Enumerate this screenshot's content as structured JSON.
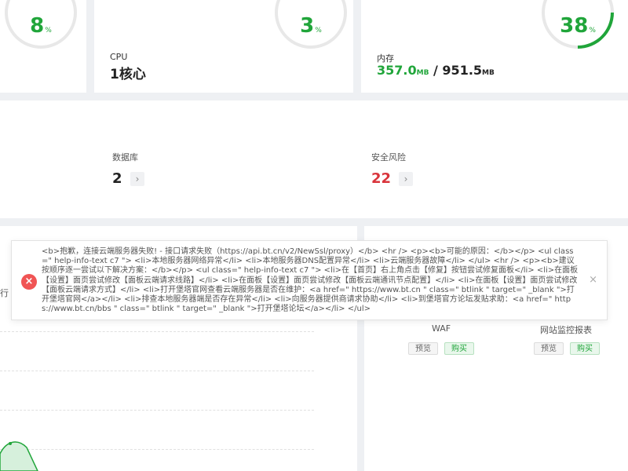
{
  "gauges": [
    {
      "value": "8",
      "unit": "%"
    },
    {
      "value": "3",
      "unit": "%"
    },
    {
      "value": "38",
      "unit": "%"
    }
  ],
  "cpu": {
    "label": "CPU",
    "value": "1核心"
  },
  "memory": {
    "label": "内存",
    "used": "357.0",
    "used_unit": "MB",
    "separator": " / ",
    "total": "951.5",
    "total_unit": "MB"
  },
  "stats": {
    "database": {
      "label": "数据库",
      "value": "2"
    },
    "security": {
      "label": "安全风险",
      "value": "22",
      "color": "#d9343b"
    }
  },
  "side_label": "行",
  "plugins": [
    {
      "name": "WAF",
      "preview": "预览",
      "buy": "购买"
    },
    {
      "name": "网站监控报表",
      "preview": "预览",
      "buy": "购买"
    }
  ],
  "error": {
    "icon": "error-icon",
    "message": "<b>抱歉，连接云端服务器失败! - 接口请求失败（https://api.bt.cn/v2/NewSsl/proxy）</b> <hr /> <p><b>可能的原因：</b></p> <ul class=\" help-info-text c7 \"> <li>本地服务器网络异常</li> <li>本地服务器DNS配置异常</li> <li>云端服务器故障</li> </ul> <hr /> <p><b>建议按顺序逐一尝试以下解决方案：</b></p> <ul class=\" help-info-text c7 \"> <li>在【首页】右上角点击【修复】按钮尝试修复面板</li> <li>在面板【设置】面页尝试修改【面板云端请求线路】</li> <li>在面板【设置】面页尝试修改【面板云端通讯节点配置】</li> <li>在面板【设置】面页尝试修改【面板云端请求方式】</li> <li>打开堡塔官网查看云端服务器是否在维护：<a href=\" https://www.bt.cn \" class=\" btlink \" target=\" _blank \">打开堡塔官网</a></li> <li>排查本地服务器端是否存在异常</li> <li>向服务器提供商请求协助</li> <li>到堡塔官方论坛发贴求助：<a href=\" https://www.bt.cn/bbs \" class=\" btlink \" target=\" _blank \">打开堡塔论坛</a></li> </ul>",
    "close": "×"
  },
  "colors": {
    "accent": "#20a53a",
    "danger": "#d9343b",
    "error_icon": "#f05454"
  }
}
